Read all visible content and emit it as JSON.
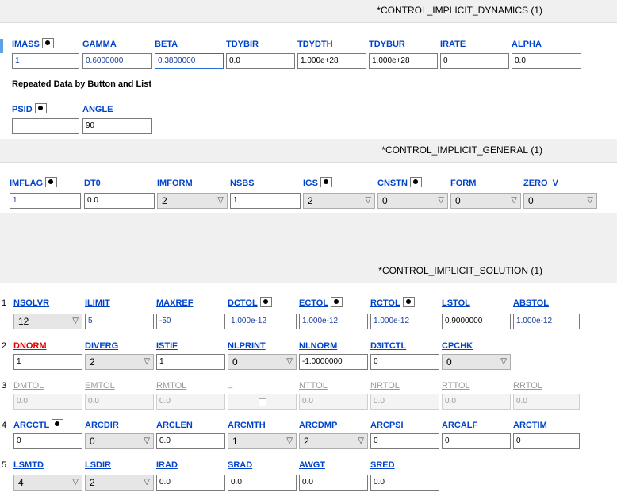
{
  "dynamics": {
    "title": "*CONTROL_IMPLICIT_DYNAMICS",
    "count": "(1)",
    "labels": [
      "IMASS",
      "GAMMA",
      "BETA",
      "TDYBIR",
      "TDYDTH",
      "TDYBUR",
      "IRATE",
      "ALPHA"
    ],
    "values": [
      "1",
      "0.6000000",
      "0.3800000",
      "0.0",
      "1.000e+28",
      "1.000e+28",
      "0",
      "0.0"
    ],
    "repeated_caption": "Repeated Data by Button and List",
    "row2_labels": [
      "PSID",
      "ANGLE"
    ],
    "row2_values": [
      "",
      "90"
    ]
  },
  "general": {
    "title": "*CONTROL_IMPLICIT_GENERAL",
    "count": "(1)",
    "labels": [
      "IMFLAG",
      "DT0",
      "IMFORM",
      "NSBS",
      "IGS",
      "CNSTN",
      "FORM",
      "ZERO_V"
    ],
    "values": [
      "1",
      "0.0",
      "2",
      "1",
      "2",
      "0",
      "0",
      "0"
    ]
  },
  "solution": {
    "title": "*CONTROL_IMPLICIT_SOLUTION",
    "count": "(1)",
    "row_numbers": [
      "1",
      "2",
      "3",
      "4",
      "5"
    ],
    "row1_labels": [
      "NSOLVR",
      "ILIMIT",
      "MAXREF",
      "DCTOL",
      "ECTOL",
      "RCTOL",
      "LSTOL",
      "ABSTOL"
    ],
    "row1_values": [
      "12",
      "5",
      "-50",
      "1.000e-12",
      "1.000e-12",
      "1.000e-12",
      "0.9000000",
      "1.000e-12"
    ],
    "row2_labels": [
      "DNORM",
      "DIVERG",
      "ISTIF",
      "NLPRINT",
      "NLNORM",
      "D3ITCTL",
      "CPCHK"
    ],
    "row2_values": [
      "1",
      "2",
      "1",
      "0",
      "-1.0000000",
      "0",
      "0"
    ],
    "row3_labels": [
      "DMTOL",
      "EMTOL",
      "RMTOL",
      "_",
      "NTTOL",
      "NRTOL",
      "RTTOL",
      "RRTOL"
    ],
    "row3_values": [
      "0.0",
      "0.0",
      "0.0",
      "",
      "0.0",
      "0.0",
      "0.0",
      "0.0"
    ],
    "row4_labels": [
      "ARCCTL",
      "ARCDIR",
      "ARCLEN",
      "ARCMTH",
      "ARCDMP",
      "ARCPSI",
      "ARCALF",
      "ARCTIM"
    ],
    "row4_values": [
      "0",
      "0",
      "0.0",
      "1",
      "2",
      "0",
      "0",
      "0"
    ],
    "row5_labels": [
      "LSMTD",
      "LSDIR",
      "IRAD",
      "SRAD",
      "AWGT",
      "SRED"
    ],
    "row5_values": [
      "4",
      "2",
      "0.0",
      "0.0",
      "0.0",
      "0.0"
    ]
  },
  "icons": {
    "dropdown": "chevron-down-icon",
    "option_button": "radio-dot-icon"
  }
}
